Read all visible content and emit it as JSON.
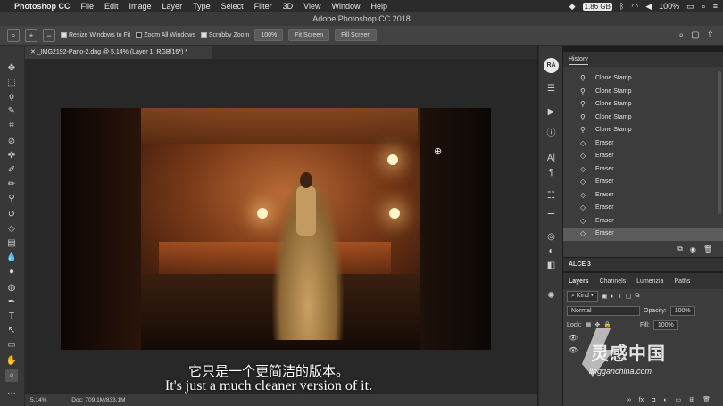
{
  "menubar": {
    "app_name": "Photoshop CC",
    "items": [
      "File",
      "Edit",
      "Image",
      "Layer",
      "Type",
      "Select",
      "Filter",
      "3D",
      "View",
      "Window",
      "Help"
    ],
    "memory": "1.86 GB",
    "battery": "100%"
  },
  "window_title": "Adobe Photoshop CC 2018",
  "options_bar": {
    "resize_windows": "Resize Windows to Fit",
    "zoom_all_windows": "Zoom All Windows",
    "scrubby_zoom": "Scrubby Zoom",
    "zoom_value": "100%",
    "fit_screen_1": "Fit Screen",
    "fit_screen_2": "Fill Screen"
  },
  "document_tab": "_IMG2192-Pano-2.dng @ 5.14% (Layer 1, RGB/16*) *",
  "status": {
    "zoom": "5.14%",
    "doc": "Doc: 709.1M/833.1M"
  },
  "subtitles": {
    "cn": "它只是一个更简洁的版本。",
    "en": "It's just a much cleaner version of it."
  },
  "avatar_initials": "RA",
  "history": {
    "title": "History",
    "items": [
      "Clone Stamp",
      "Clone Stamp",
      "Clone Stamp",
      "Clone Stamp",
      "Clone Stamp",
      "Eraser",
      "Eraser",
      "Eraser",
      "Eraser",
      "Eraser",
      "Eraser",
      "Eraser",
      "Eraser"
    ]
  },
  "alce_label": "ALCE 3",
  "layers_panel": {
    "tabs": [
      "Layers",
      "Channels",
      "Lumenzia",
      "Paths"
    ],
    "kind": "Kind",
    "blend_mode": "Normal",
    "opacity_label": "Opacity:",
    "opacity_value": "100%",
    "lock_label": "Lock:",
    "fill_label": "Fill:",
    "fill_value": "100%"
  },
  "watermark": {
    "text": "灵感中国",
    "url": "lingganchina.com"
  }
}
